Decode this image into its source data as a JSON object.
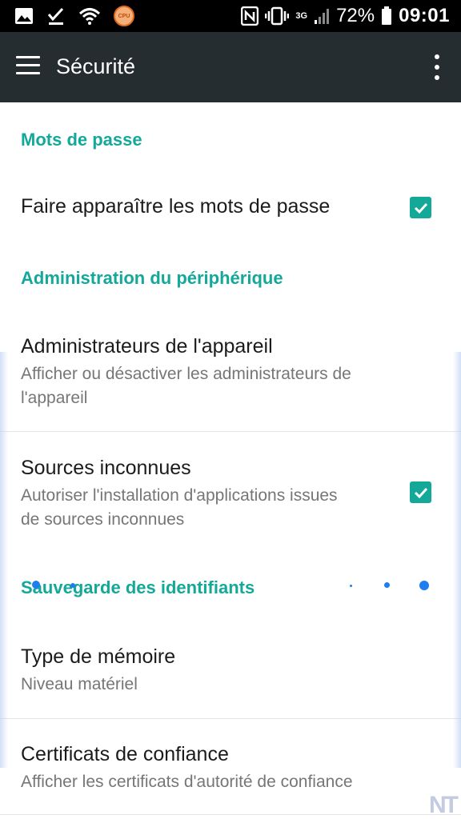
{
  "status_bar": {
    "left_icons": [
      "image-icon",
      "check-icon",
      "wifi-icon",
      "cpu-icon"
    ],
    "cpu_label": "CPU",
    "right_icons": [
      "nfc-icon",
      "vibrate-icon",
      "signal-icon",
      "battery-icon"
    ],
    "network": "3G",
    "battery": "72%",
    "time": "09:01"
  },
  "toolbar": {
    "title": "Sécurité"
  },
  "sections": {
    "passwords": {
      "header": "Mots de passe",
      "show_passwords": {
        "title": "Faire apparaître les mots de passe",
        "checked": true
      }
    },
    "device_admin": {
      "header": "Administration du périphérique",
      "admins": {
        "title": "Administrateurs de l'appareil",
        "summary": "Afficher ou désactiver les administrateurs de l'appareil"
      },
      "unknown_sources": {
        "title": "Sources inconnues",
        "summary": "Autoriser l'installation d'applications issues de sources inconnues",
        "checked": true
      }
    },
    "credentials": {
      "header": "Sauvegarde des identifiants",
      "storage_type": {
        "title": "Type de mémoire",
        "summary": "Niveau matériel"
      },
      "trusted_certs": {
        "title": "Certificats de confiance",
        "summary": "Afficher les certificats d'autorité de confiance"
      }
    }
  },
  "colors": {
    "accent": "#14a89a",
    "toolbar": "#252d30",
    "status_bar": "#000000"
  },
  "watermark": "NT"
}
